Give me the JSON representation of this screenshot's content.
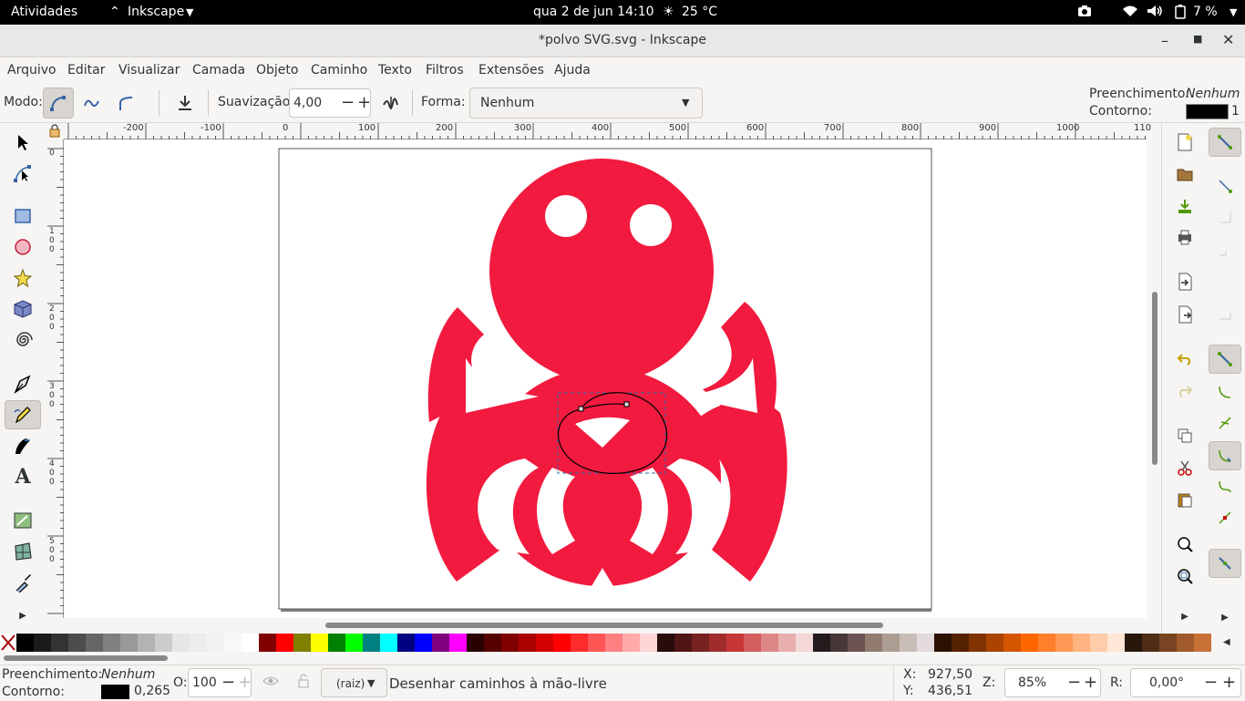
{
  "topbar": {
    "activities": "Atividades",
    "app": "Inkscape",
    "clock": "qua 2 de jun  14:10",
    "weather": "25 °C",
    "battery": "7 %"
  },
  "window": {
    "title": "*polvo SVG.svg - Inkscape"
  },
  "menu": [
    "Arquivo",
    "Editar",
    "Visualizar",
    "Camada",
    "Objeto",
    "Caminho",
    "Texto",
    "Filtros",
    "Extensões",
    "Ajuda"
  ],
  "toolctl": {
    "mode_label": "Modo:",
    "smooth_label": "Suavização:",
    "smooth_value": "4,00",
    "shape_label": "Forma:",
    "shape_value": "Nenhum",
    "fill_label": "Preenchimento:",
    "fill_value": "Nenhum",
    "stroke_label": "Contorno:",
    "stroke_value": "1"
  },
  "ruler": {
    "h": [
      "-200",
      "-100",
      "0",
      "100",
      "200",
      "300",
      "400",
      "500",
      "600",
      "700",
      "800",
      "900",
      "1000",
      "110"
    ],
    "v": [
      "0",
      "1 0 0",
      "2 0 0",
      "3 0 0",
      "4 0 0",
      "5 0 0"
    ]
  },
  "icons": {
    "colors": {
      "octopus": "#f21a3e",
      "accent": "#3465a4"
    }
  },
  "palette": [
    "#000000",
    "#1a1a1a",
    "#333333",
    "#4d4d4d",
    "#666666",
    "#808080",
    "#999999",
    "#b3b3b3",
    "#cccccc",
    "#e6e6e6",
    "#ececec",
    "#f2f2f2",
    "#f8f8f8",
    "#ffffff",
    "#800000",
    "#ff0000",
    "#808000",
    "#ffff00",
    "#008000",
    "#00ff00",
    "#008080",
    "#00ffff",
    "#000080",
    "#0000ff",
    "#800080",
    "#ff00ff",
    "#2b0000",
    "#550000",
    "#800000",
    "#aa0000",
    "#d40000",
    "#ff0000",
    "#ff2a2a",
    "#ff5555",
    "#ff8080",
    "#ffaaaa",
    "#ffd5d5",
    "#280b0b",
    "#501616",
    "#782121",
    "#a02c2c",
    "#c83737",
    "#d35f5f",
    "#de8787",
    "#e9afaf",
    "#f4d7d7",
    "#241c1c",
    "#483737",
    "#6c5353",
    "#917c6f",
    "#ac9d93",
    "#c8beb7",
    "#e3dbdb",
    "#2b1100",
    "#552200",
    "#803300",
    "#aa4400",
    "#d45500",
    "#ff6600",
    "#ff7f2a",
    "#ff9955",
    "#ffb380",
    "#ffccaa",
    "#ffe6d5",
    "#28170b",
    "#502d16",
    "#784421",
    "#a05a2c",
    "#c87137"
  ],
  "status": {
    "fill_label": "Preenchimento:",
    "fill_value": "Nenhum",
    "stroke_label": "Contorno:",
    "stroke_width": "0,265",
    "opacity_label": "O:",
    "opacity_value": "100",
    "layer": "(raiz)",
    "message": "Desenhar caminhos à mão-livre",
    "x_label": "X:",
    "x_value": "927,50",
    "y_label": "Y:",
    "y_value": "436,51",
    "zoom_label": "Z:",
    "zoom_value": "85%",
    "rot_label": "R:",
    "rot_value": "0,00°"
  }
}
